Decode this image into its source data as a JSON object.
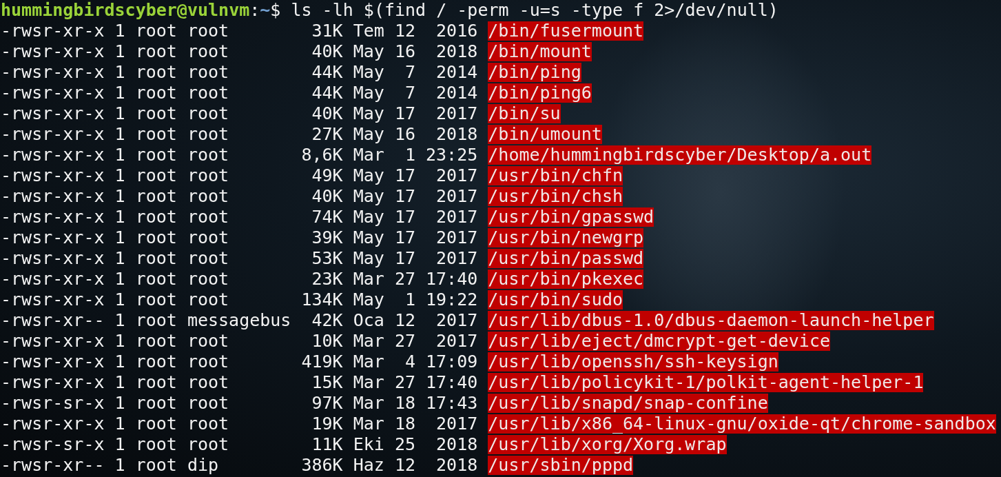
{
  "prompt": {
    "user_host": "hummingbirdscyber@vulnvm",
    "separator": ":",
    "path": "~",
    "symbol": "$",
    "command": "ls -lh $(find / -perm -u=s -type f 2>/dev/null)"
  },
  "rows": [
    {
      "permissions": "-rwsr-xr-x",
      "links": "1",
      "owner": "root",
      "group": "root",
      "size": "31K",
      "month": "Tem",
      "day": "12",
      "time": "2016",
      "path": "/bin/fusermount"
    },
    {
      "permissions": "-rwsr-xr-x",
      "links": "1",
      "owner": "root",
      "group": "root",
      "size": "40K",
      "month": "May",
      "day": "16",
      "time": "2018",
      "path": "/bin/mount"
    },
    {
      "permissions": "-rwsr-xr-x",
      "links": "1",
      "owner": "root",
      "group": "root",
      "size": "44K",
      "month": "May",
      "day": "7",
      "time": "2014",
      "path": "/bin/ping"
    },
    {
      "permissions": "-rwsr-xr-x",
      "links": "1",
      "owner": "root",
      "group": "root",
      "size": "44K",
      "month": "May",
      "day": "7",
      "time": "2014",
      "path": "/bin/ping6"
    },
    {
      "permissions": "-rwsr-xr-x",
      "links": "1",
      "owner": "root",
      "group": "root",
      "size": "40K",
      "month": "May",
      "day": "17",
      "time": "2017",
      "path": "/bin/su"
    },
    {
      "permissions": "-rwsr-xr-x",
      "links": "1",
      "owner": "root",
      "group": "root",
      "size": "27K",
      "month": "May",
      "day": "16",
      "time": "2018",
      "path": "/bin/umount"
    },
    {
      "permissions": "-rwsr-xr-x",
      "links": "1",
      "owner": "root",
      "group": "root",
      "size": "8,6K",
      "month": "Mar",
      "day": "1",
      "time": "23:25",
      "path": "/home/hummingbirdscyber/Desktop/a.out"
    },
    {
      "permissions": "-rwsr-xr-x",
      "links": "1",
      "owner": "root",
      "group": "root",
      "size": "49K",
      "month": "May",
      "day": "17",
      "time": "2017",
      "path": "/usr/bin/chfn"
    },
    {
      "permissions": "-rwsr-xr-x",
      "links": "1",
      "owner": "root",
      "group": "root",
      "size": "40K",
      "month": "May",
      "day": "17",
      "time": "2017",
      "path": "/usr/bin/chsh"
    },
    {
      "permissions": "-rwsr-xr-x",
      "links": "1",
      "owner": "root",
      "group": "root",
      "size": "74K",
      "month": "May",
      "day": "17",
      "time": "2017",
      "path": "/usr/bin/gpasswd"
    },
    {
      "permissions": "-rwsr-xr-x",
      "links": "1",
      "owner": "root",
      "group": "root",
      "size": "39K",
      "month": "May",
      "day": "17",
      "time": "2017",
      "path": "/usr/bin/newgrp"
    },
    {
      "permissions": "-rwsr-xr-x",
      "links": "1",
      "owner": "root",
      "group": "root",
      "size": "53K",
      "month": "May",
      "day": "17",
      "time": "2017",
      "path": "/usr/bin/passwd"
    },
    {
      "permissions": "-rwsr-xr-x",
      "links": "1",
      "owner": "root",
      "group": "root",
      "size": "23K",
      "month": "Mar",
      "day": "27",
      "time": "17:40",
      "path": "/usr/bin/pkexec"
    },
    {
      "permissions": "-rwsr-xr-x",
      "links": "1",
      "owner": "root",
      "group": "root",
      "size": "134K",
      "month": "May",
      "day": "1",
      "time": "19:22",
      "path": "/usr/bin/sudo"
    },
    {
      "permissions": "-rwsr-xr--",
      "links": "1",
      "owner": "root",
      "group": "messagebus",
      "size": "42K",
      "month": "Oca",
      "day": "12",
      "time": "2017",
      "path": "/usr/lib/dbus-1.0/dbus-daemon-launch-helper"
    },
    {
      "permissions": "-rwsr-xr-x",
      "links": "1",
      "owner": "root",
      "group": "root",
      "size": "10K",
      "month": "Mar",
      "day": "27",
      "time": "2017",
      "path": "/usr/lib/eject/dmcrypt-get-device"
    },
    {
      "permissions": "-rwsr-xr-x",
      "links": "1",
      "owner": "root",
      "group": "root",
      "size": "419K",
      "month": "Mar",
      "day": "4",
      "time": "17:09",
      "path": "/usr/lib/openssh/ssh-keysign"
    },
    {
      "permissions": "-rwsr-xr-x",
      "links": "1",
      "owner": "root",
      "group": "root",
      "size": "15K",
      "month": "Mar",
      "day": "27",
      "time": "17:40",
      "path": "/usr/lib/policykit-1/polkit-agent-helper-1"
    },
    {
      "permissions": "-rwsr-sr-x",
      "links": "1",
      "owner": "root",
      "group": "root",
      "size": "97K",
      "month": "Mar",
      "day": "18",
      "time": "17:43",
      "path": "/usr/lib/snapd/snap-confine"
    },
    {
      "permissions": "-rwsr-xr-x",
      "links": "1",
      "owner": "root",
      "group": "root",
      "size": "19K",
      "month": "Mar",
      "day": "18",
      "time": "2017",
      "path": "/usr/lib/x86_64-linux-gnu/oxide-qt/chrome-sandbox"
    },
    {
      "permissions": "-rwsr-sr-x",
      "links": "1",
      "owner": "root",
      "group": "root",
      "size": "11K",
      "month": "Eki",
      "day": "25",
      "time": "2018",
      "path": "/usr/lib/xorg/Xorg.wrap"
    },
    {
      "permissions": "-rwsr-xr--",
      "links": "1",
      "owner": "root",
      "group": "dip",
      "size": "386K",
      "month": "Haz",
      "day": "12",
      "time": "2018",
      "path": "/usr/sbin/pppd"
    }
  ]
}
